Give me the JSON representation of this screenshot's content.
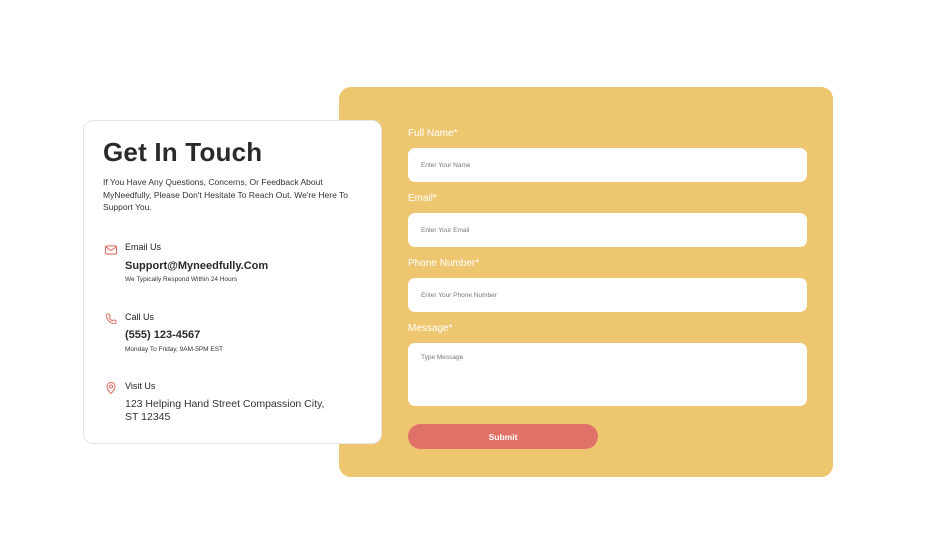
{
  "info": {
    "title": "Get In Touch",
    "intro": "If You Have Any Questions, Concerns, Or Feedback About MyNeedfully, Please Don't Hesitate To Reach Out. We're Here To Support You.",
    "email": {
      "label": "Email Us",
      "value": "Support@Myneedfully.Com",
      "note": "We Typically Respond Within 24 Hours",
      "icon": "mail-icon"
    },
    "call": {
      "label": "Call Us",
      "value": "(555) 123-4567",
      "note": "Monday To Friday, 9AM-5PM EST",
      "icon": "phone-icon"
    },
    "visit": {
      "label": "Visit Us",
      "value": "123 Helping Hand Street Compassion City, ST 12345",
      "icon": "location-pin-icon"
    }
  },
  "form": {
    "full_name": {
      "label": "Full Name*",
      "placeholder": "Enter Your Name"
    },
    "email": {
      "label": "Email*",
      "placeholder": "Enter Your Email"
    },
    "phone": {
      "label": "Phone Number*",
      "placeholder": "Enter Your Phone Number"
    },
    "message": {
      "label": "Message*",
      "placeholder": "Type Message"
    },
    "submit_label": "Submit"
  },
  "colors": {
    "form_background": "#EEC66F",
    "accent": "#E07168",
    "card_background": "#FFFFFF"
  }
}
